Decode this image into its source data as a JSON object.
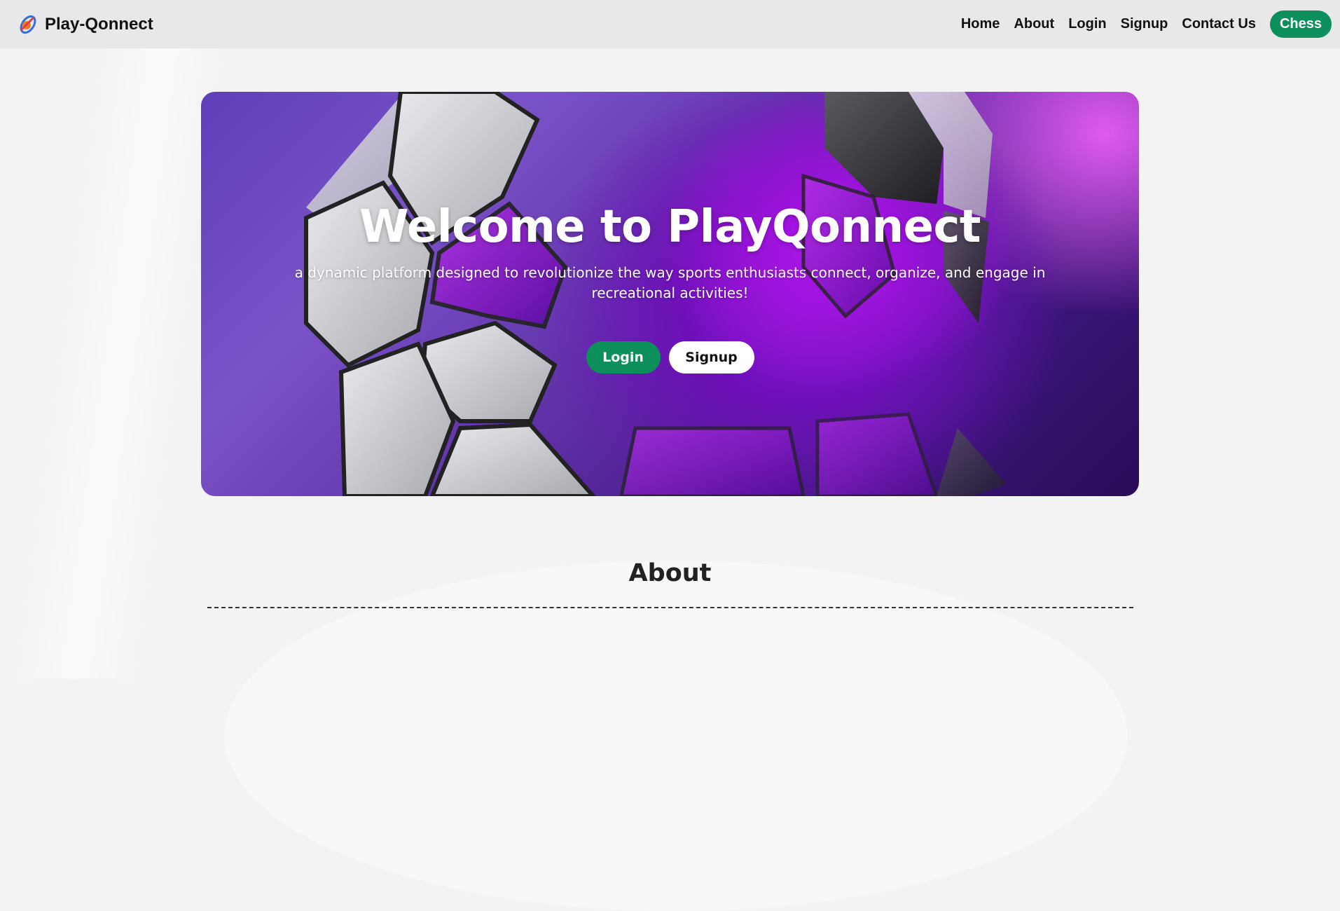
{
  "navbar": {
    "brand_name": "Play-Qonnect",
    "brand_icon": "logo-icon",
    "links": {
      "home": "Home",
      "about": "About",
      "login": "Login",
      "signup": "Signup",
      "contact": "Contact Us",
      "chess": "Chess"
    }
  },
  "hero": {
    "title": "Welcome to PlayQonnect",
    "subtitle": "a dynamic platform designed to revolutionize the way sports enthusiasts connect, organize, and engage in recreational activities!",
    "login_label": "Login",
    "signup_label": "Signup"
  },
  "about": {
    "title": "About"
  },
  "colors": {
    "accent_green": "#0c8f5a",
    "hero_purple": "#8e15d8",
    "navbar_bg": "#e8e8e8"
  }
}
